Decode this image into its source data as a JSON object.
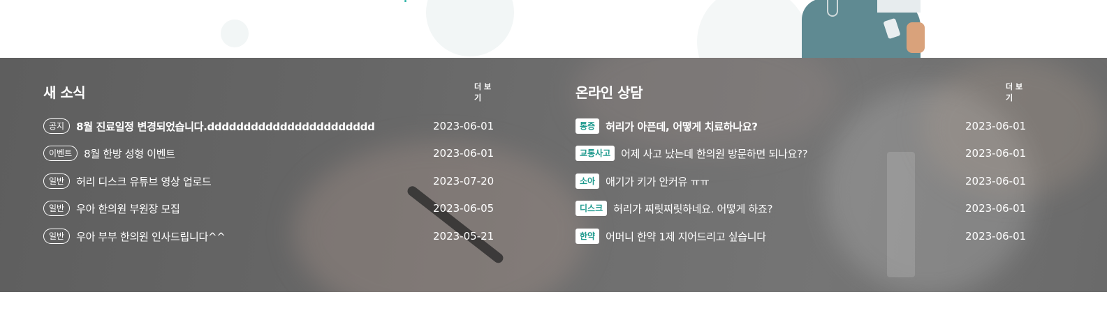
{
  "news": {
    "title": "새 소식",
    "more_label": "더 보기",
    "items": [
      {
        "category": "공지",
        "title": "8월 진료일정 변경되었습니다.ddddddddddddddddddddddd",
        "date": "2023-06-01",
        "bold": true
      },
      {
        "category": "이벤트",
        "title": "8월 한방 성형 이벤트",
        "date": "2023-06-01",
        "bold": false
      },
      {
        "category": "일반",
        "title": "허리 디스크 유튜브 영상 업로드",
        "date": "2023-07-20",
        "bold": false
      },
      {
        "category": "일반",
        "title": "우아 한의원 부원장 모집",
        "date": "2023-06-05",
        "bold": false
      },
      {
        "category": "일반",
        "title": "우아 부부 한의원 인사드립니다^^",
        "date": "2023-05-21",
        "bold": false
      }
    ]
  },
  "consult": {
    "title": "온라인 상담",
    "more_label": "더 보기",
    "items": [
      {
        "category": "통증",
        "title": "허리가 아픈데, 어떻게 치료하나요?",
        "date": "2023-06-01",
        "bold": true
      },
      {
        "category": "교통사고",
        "title": "어제 사고 났는데 한의원 방문하면 되나요??",
        "date": "2023-06-01",
        "bold": false
      },
      {
        "category": "소아",
        "title": "애기가 키가 안커유 ㅠㅠ",
        "date": "2023-06-01",
        "bold": false
      },
      {
        "category": "디스크",
        "title": "허리가 찌릿찌릿하네요. 어떻게 하죠?",
        "date": "2023-06-01",
        "bold": false
      },
      {
        "category": "한약",
        "title": "어머니 한약 1제 지어드리고 싶습니다",
        "date": "2023-06-01",
        "bold": false
      }
    ]
  },
  "colors": {
    "accent": "#1f9a8e",
    "band": "#666666"
  }
}
